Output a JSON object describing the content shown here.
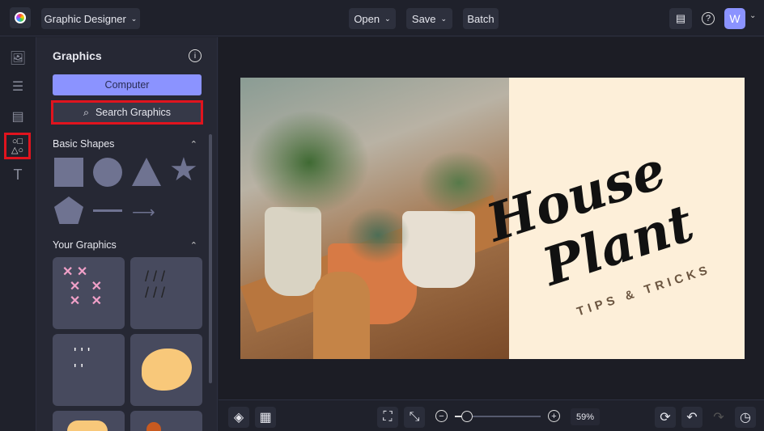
{
  "topbar": {
    "app_mode": "Graphic Designer",
    "open": "Open",
    "save": "Save",
    "batch": "Batch",
    "avatar": "W"
  },
  "panel": {
    "title": "Graphics",
    "computer": "Computer",
    "search": "Search Graphics",
    "basic_shapes": "Basic Shapes",
    "your_graphics": "Your Graphics"
  },
  "canvas": {
    "title_line1": "House",
    "title_line2": "Plant",
    "subtitle": "TIPS & TRICKS"
  },
  "bottom": {
    "zoom_percent": "59%",
    "zoom_value": 59
  },
  "colors": {
    "accent": "#8b93ff",
    "highlight": "#e0141e",
    "cream": "#fdefd9"
  }
}
